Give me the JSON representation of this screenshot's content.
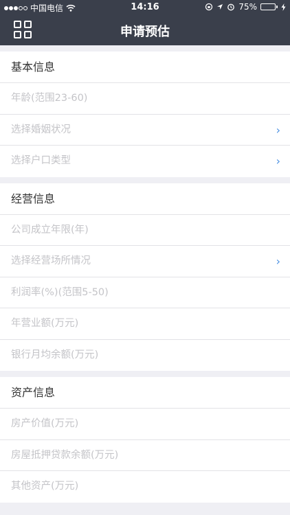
{
  "status_bar": {
    "carrier": "中国电信",
    "time": "14:16",
    "battery": "75%",
    "battery_level": 0.75
  },
  "nav": {
    "title": "申请预估",
    "menu_icon": "grid-icon"
  },
  "sections": {
    "basic": {
      "title": "基本信息",
      "age_placeholder": "年龄(范围23-60)",
      "marital_placeholder": "选择婚姻状况",
      "hukou_placeholder": "选择户口类型"
    },
    "business": {
      "title": "经营信息",
      "years_placeholder": "公司成立年限(年)",
      "premises_placeholder": "选择经营场所情况",
      "profit_placeholder": "利润率(%)(范围5-50)",
      "revenue_placeholder": "年营业额(万元)",
      "balance_placeholder": "银行月均余额(万元)"
    },
    "assets": {
      "title": "资产信息",
      "property_placeholder": "房产价值(万元)",
      "mortgage_placeholder": "房屋抵押贷款余额(万元)",
      "other_placeholder": "其他资产(万元)"
    }
  },
  "colors": {
    "header_bg": "#3a3f4b",
    "accent": "#4a90e2",
    "page_bg": "#efeff4"
  }
}
